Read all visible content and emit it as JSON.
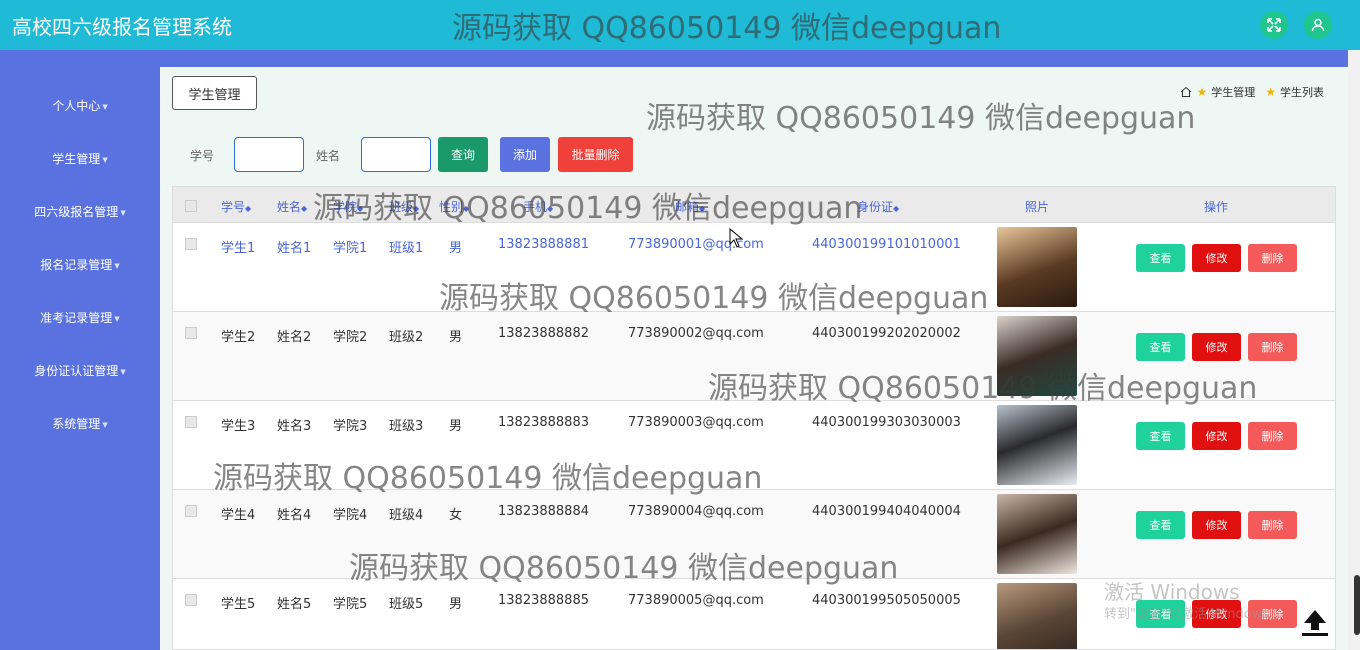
{
  "header": {
    "title": "高校四六级报名管理系统",
    "fullscreen_icon": "expand-icon",
    "user_icon": "user-icon"
  },
  "sidebar": {
    "items": [
      {
        "label": "个人中心"
      },
      {
        "label": "学生管理"
      },
      {
        "label": "四六级报名管理"
      },
      {
        "label": "报名记录管理"
      },
      {
        "label": "准考记录管理"
      },
      {
        "label": "身份证认证管理"
      },
      {
        "label": "系统管理"
      }
    ]
  },
  "breadcrumb": {
    "button": "学生管理",
    "path": [
      "学生管理",
      "学生列表"
    ]
  },
  "search": {
    "field1_label": "学号",
    "field1_value": "",
    "field2_label": "姓名",
    "field2_value": "",
    "query": "查询",
    "add": "添加",
    "batch_delete": "批量删除"
  },
  "table": {
    "columns": [
      "学号",
      "姓名",
      "学院",
      "班级",
      "性别",
      "手机",
      "邮箱",
      "身份证",
      "照片",
      "操作"
    ],
    "rows": [
      {
        "id": "学生1",
        "name": "姓名1",
        "college": "学院1",
        "class": "班级1",
        "gender": "男",
        "phone": "13823888881",
        "email": "773890001@qq.com",
        "idcard": "440300199101010001"
      },
      {
        "id": "学生2",
        "name": "姓名2",
        "college": "学院2",
        "class": "班级2",
        "gender": "男",
        "phone": "13823888882",
        "email": "773890002@qq.com",
        "idcard": "440300199202020002"
      },
      {
        "id": "学生3",
        "name": "姓名3",
        "college": "学院3",
        "class": "班级3",
        "gender": "男",
        "phone": "13823888883",
        "email": "773890003@qq.com",
        "idcard": "440300199303030003"
      },
      {
        "id": "学生4",
        "name": "姓名4",
        "college": "学院4",
        "class": "班级4",
        "gender": "女",
        "phone": "13823888884",
        "email": "773890004@qq.com",
        "idcard": "440300199404040004"
      },
      {
        "id": "学生5",
        "name": "姓名5",
        "college": "学院5",
        "class": "班级5",
        "gender": "男",
        "phone": "13823888885",
        "email": "773890005@qq.com",
        "idcard": "440300199505050005"
      }
    ],
    "actions": {
      "view": "查看",
      "edit": "修改",
      "delete": "删除"
    }
  },
  "watermark": "源码获取 QQ86050149 微信deepguan",
  "windows_activation": {
    "line1": "激活 Windows",
    "line2": "转到\"设置\"以激活 Windows。"
  },
  "colors": {
    "topbar": "#1fbad6",
    "sidebar": "#5a72df",
    "query": "#1a9a6c",
    "add": "#5a72df",
    "batch_delete": "#f0403a",
    "view": "#1fd19a",
    "edit": "#e01010",
    "delete": "#f45a5a"
  }
}
